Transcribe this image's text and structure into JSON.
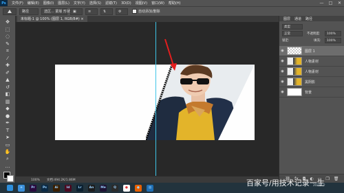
{
  "app": {
    "logo": "Ps"
  },
  "menu": [
    "文件(F)",
    "编辑(E)",
    "图像(I)",
    "图层(L)",
    "文字(Y)",
    "选择(S)",
    "滤镜(T)",
    "3D(D)",
    "视图(V)",
    "窗口(W)",
    "帮助(H)"
  ],
  "window_controls": [
    "—",
    "□",
    "✕"
  ],
  "options": {
    "tool_icon": "brush",
    "mode_value": "路径",
    "extra_value": "自动添加/删除",
    "checkbox_checked": true
  },
  "document": {
    "tab_title": "未标题-1 @ 100% (图层 1, RGB/8#) ×"
  },
  "status": {
    "zoom": "100%",
    "doc_info": "文档:494.2K/1.86M"
  },
  "panel": {
    "tabs": [
      "图层",
      "通道",
      "路径"
    ],
    "kind_filter": "类型",
    "blend_mode": "正常",
    "opacity_label": "不透明度:",
    "opacity_value": "100%",
    "lock_label": "锁定:",
    "fill_label": "填充:",
    "fill_value": "100%",
    "layers": [
      {
        "name": "图层 1",
        "visible": true,
        "selected": true,
        "thumb": "checker"
      },
      {
        "name": "人物素材",
        "visible": true,
        "selected": false,
        "thumb": "photo"
      },
      {
        "name": "人物素材",
        "visible": true,
        "selected": false,
        "thumb": "photo"
      },
      {
        "name": "黑阴影",
        "visible": true,
        "selected": false,
        "thumb": "photo"
      },
      {
        "name": "背景",
        "visible": true,
        "selected": false,
        "thumb": "white"
      }
    ],
    "bottom_icons": [
      "link-icon",
      "fx-icon",
      "mask-icon",
      "adjust-icon",
      "folder-icon",
      "new-layer-icon",
      "trash-icon"
    ]
  },
  "tool_icons": [
    "move",
    "marquee",
    "lasso",
    "quick-select",
    "crop",
    "eyedropper",
    "healing",
    "brush",
    "stamp",
    "history-brush",
    "eraser",
    "gradient",
    "blur",
    "dodge",
    "pen",
    "type",
    "path-select",
    "shape",
    "hand",
    "zoom",
    "more"
  ],
  "taskbar": {
    "apps": [
      {
        "name": "edge",
        "label": "e",
        "color": "#3b8fd9"
      },
      {
        "name": "pr",
        "label": "Pr",
        "color": "#2a0a3d"
      },
      {
        "name": "ps",
        "label": "Ps",
        "color": "#0b2a45"
      },
      {
        "name": "ai",
        "label": "Ai",
        "color": "#3a1f00"
      },
      {
        "name": "id",
        "label": "Id",
        "color": "#4a0a20"
      },
      {
        "name": "lr",
        "label": "Lr",
        "color": "#0b2030"
      },
      {
        "name": "an",
        "label": "An",
        "color": "#1d1d1d"
      },
      {
        "name": "me",
        "label": "Me",
        "color": "#1e1233"
      },
      {
        "name": "qq",
        "label": "Q",
        "color": "#2b2b2b"
      },
      {
        "name": "chrome",
        "label": "●",
        "color": "#ffffff"
      },
      {
        "name": "firefox",
        "label": "●",
        "color": "#e66000"
      },
      {
        "name": "files",
        "label": "▤",
        "color": "#1f6fb5"
      }
    ],
    "tray_date": "2020/1/?"
  },
  "watermark": "百家号/用技术记录一生",
  "colors": {
    "ui_gray": "#535353",
    "canvas": "#282828",
    "guide": "#3fc5e8",
    "arrow": "#e51e1e",
    "selection": "#6d6d6d"
  }
}
